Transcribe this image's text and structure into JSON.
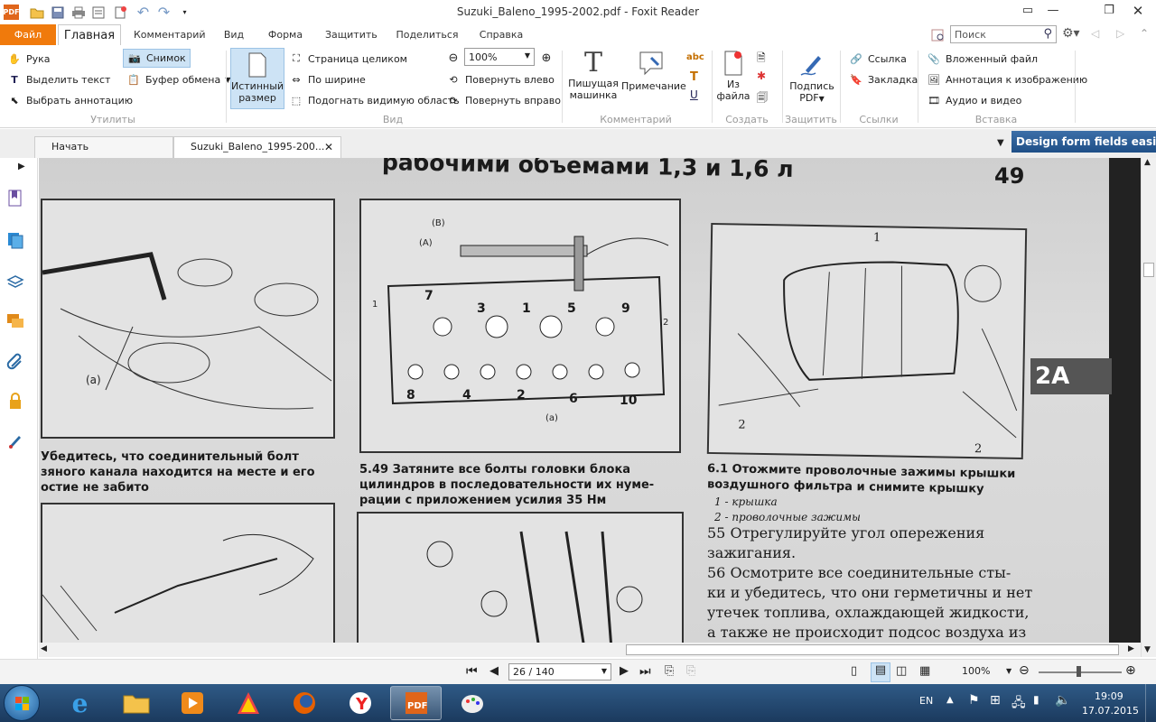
{
  "window": {
    "title": "Suzuki_Baleno_1995-2002.pdf - Foxit Reader"
  },
  "menu": {
    "file": "Файл",
    "tabs": [
      "Главная",
      "Комментарий",
      "Вид",
      "Форма",
      "Защитить",
      "Поделиться",
      "Справка"
    ]
  },
  "search": {
    "placeholder": "Поиск"
  },
  "ribbon": {
    "hand": "Рука",
    "select_text": "Выделить текст",
    "select_annot": "Выбрать аннотацию",
    "snapshot": "Снимок",
    "clipboard": "Буфер обмена",
    "utilities": "Утилиты",
    "actual_size_line1": "Истинный",
    "actual_size_line2": "размер",
    "fit_page": "Страница целиком",
    "fit_width": "По ширине",
    "fit_visible": "Подогнать видимую область",
    "zoom": "100%",
    "rotate_left": "Повернуть влево",
    "rotate_right": "Повернуть вправо",
    "view": "Вид",
    "typewriter_line1": "Пишущая",
    "typewriter_line2": "машинка",
    "note": "Примечание",
    "comment": "Комментарий",
    "from_file_line1": "Из",
    "from_file_line2": "файла",
    "create": "Создать",
    "sign_line1": "Подпись",
    "sign_line2": "PDF",
    "protect": "Защитить",
    "link": "Ссылка",
    "bookmark": "Закладка",
    "links": "Ссылки",
    "attach": "Вложенный файл",
    "image_annot": "Аннотация к изображению",
    "audio_video": "Аудио и видео",
    "insert": "Вставка"
  },
  "doctabs": {
    "start": "Начать",
    "doc": "Suzuki_Baleno_1995-200...",
    "banner": "Design form fields easily"
  },
  "page": {
    "header": "рабочими объемами 1,3 и 1,6 л",
    "page_num": "49",
    "section_tag": "2А",
    "left_caption": [
      "Убедитесь, что соединительный болт",
      "зяного канала находится на месте и его",
      "остие не забито"
    ],
    "fig1_label": "(a)",
    "mid_caption": [
      "5.49 Затяните все болты головки блока",
      "цилиндров в последовательности их нуме-",
      "рации с приложением усилия 35 Нм"
    ],
    "bolt_numbers_top": [
      "7",
      "3",
      "1",
      "5",
      "9"
    ],
    "bolt_numbers_bottom": [
      "8",
      "4",
      "2",
      "6",
      "10"
    ],
    "fig2_labels": [
      "(B)",
      "(A)",
      "(a)",
      "1",
      "2"
    ],
    "right_caption": [
      "6.1 Отожмите проволочные зажимы крышки",
      "воздушного фильтра и снимите крышку"
    ],
    "legend": [
      "1 -  крышка",
      "2 -  проволочные зажимы"
    ],
    "step55": [
      "55  Отрегулируйте угол опережения",
      "зажигания."
    ],
    "step56": [
      "56  Осмотрите все соединительные сты-",
      "ки и убедитесь, что они герметичны и нет",
      "утечек топлива, охлаждающей жидкости,",
      "а также не происходит подсос воздуха из"
    ],
    "fig3_labels": [
      "1",
      "2",
      "2"
    ]
  },
  "statusbar": {
    "page": "26 / 140",
    "zoom": "100%"
  },
  "taskbar": {
    "lang": "EN",
    "time": "19:09",
    "date": "17.07.2015"
  }
}
